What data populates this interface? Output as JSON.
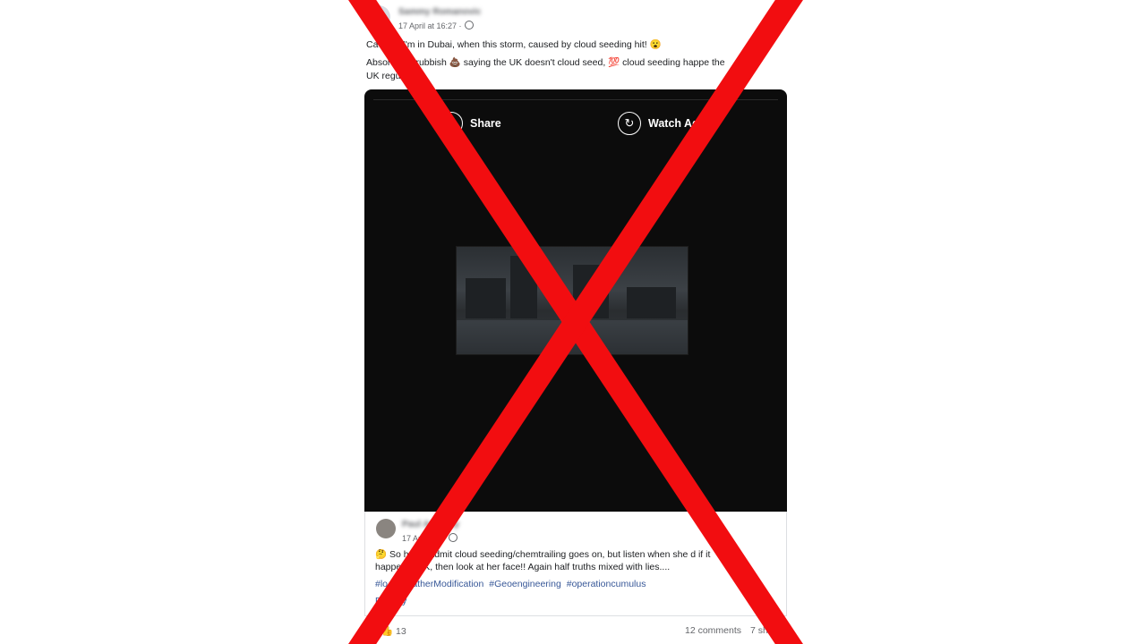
{
  "post": {
    "author": "Sammy Romanovic",
    "timestamp": "17 April at 16:27 ·",
    "line1": "Ca    lieve I'm in Dubai, when this storm, caused by cloud seeding hit! 😮",
    "line2": "Absol     ud of rubbish 💩 saying the UK doesn't cloud seed, 💯 cloud seeding happe      the",
    "line3": "UK regu"
  },
  "video": {
    "share_label": "Share",
    "watch_again_label": "Watch Ag"
  },
  "comment": {
    "author": "Paul Anthony",
    "timestamp": "17 Ap      2:10 ·",
    "line1": "🤔 So he      ey admit cloud seeding/chemtrailing goes on, but listen when she        d if it",
    "line2": "happe       he UK, then look at her face!! Again half truths mixed with lies....",
    "hashtags": [
      "#lo",
      "#WeatherModification",
      "#Geoengineering",
      "#operationcumulus"
    ],
    "more": "P    thony"
  },
  "footer": {
    "reactions": "13",
    "comments": "12 comments",
    "shares": "7 sh"
  },
  "colors": {
    "cross": "#f20d10",
    "video_bg": "#0c0c0c",
    "link": "#385898"
  }
}
